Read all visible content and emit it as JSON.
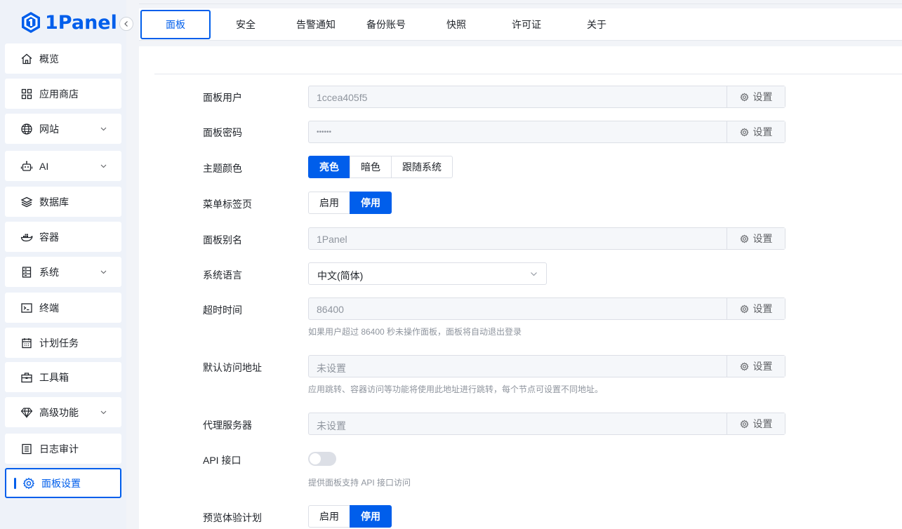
{
  "app": {
    "logo_text": "1Panel"
  },
  "sidebar": {
    "items": [
      {
        "label": "概览",
        "icon": "home-icon"
      },
      {
        "label": "应用商店",
        "icon": "grid-icon"
      },
      {
        "label": "网站",
        "icon": "globe-icon",
        "expandable": true
      },
      {
        "label": "AI",
        "icon": "robot-icon",
        "expandable": true
      },
      {
        "label": "数据库",
        "icon": "layers-icon"
      },
      {
        "label": "容器",
        "icon": "docker-icon"
      },
      {
        "label": "系统",
        "icon": "server-icon",
        "expandable": true
      },
      {
        "label": "终端",
        "icon": "terminal-icon"
      },
      {
        "label": "计划任务",
        "icon": "calendar-icon"
      },
      {
        "label": "工具箱",
        "icon": "toolbox-icon"
      },
      {
        "label": "高级功能",
        "icon": "diamond-icon",
        "expandable": true
      },
      {
        "label": "日志审计",
        "icon": "log-icon"
      },
      {
        "label": "面板设置",
        "icon": "gear-icon",
        "active": true
      }
    ]
  },
  "tabs": [
    {
      "label": "面板",
      "active": true
    },
    {
      "label": "安全"
    },
    {
      "label": "告警通知"
    },
    {
      "label": "备份账号"
    },
    {
      "label": "快照"
    },
    {
      "label": "许可证"
    },
    {
      "label": "关于"
    }
  ],
  "settings": {
    "set_label": "设置",
    "panel_user": {
      "label": "面板用户",
      "value": "1ccea405f5"
    },
    "panel_password": {
      "label": "面板密码",
      "value": "••••••"
    },
    "theme": {
      "label": "主题颜色",
      "options": [
        "亮色",
        "暗色",
        "跟随系统"
      ],
      "selected": "亮色"
    },
    "menu_tabs": {
      "label": "菜单标签页",
      "options": [
        "启用",
        "停用"
      ],
      "selected": "停用"
    },
    "panel_alias": {
      "label": "面板别名",
      "value": "1Panel"
    },
    "language": {
      "label": "系统语言",
      "value": "中文(简体)"
    },
    "timeout": {
      "label": "超时时间",
      "value": "86400",
      "hint": "如果用户超过 86400 秒未操作面板，面板将自动退出登录"
    },
    "default_address": {
      "label": "默认访问地址",
      "value": "未设置",
      "hint": "应用跳转、容器访问等功能将使用此地址进行跳转，每个节点可设置不同地址。"
    },
    "proxy": {
      "label": "代理服务器",
      "value": "未设置"
    },
    "api": {
      "label": "API 接口",
      "enabled": false,
      "hint": "提供面板支持 API 接口访问"
    },
    "preview": {
      "label": "预览体验计划",
      "options": [
        "启用",
        "停用"
      ],
      "selected": "停用"
    }
  },
  "colors": {
    "accent": "#005eeb",
    "sidebar_bg": "#eef2f9",
    "input_bg": "#f5f7fa"
  }
}
